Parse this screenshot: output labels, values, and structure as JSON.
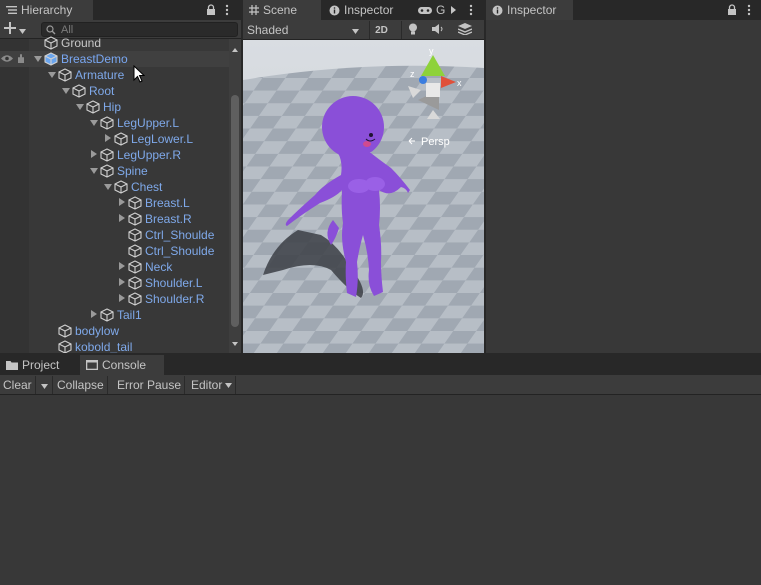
{
  "hierarchy": {
    "tab_label": "Hierarchy",
    "search_placeholder": "All",
    "items": [
      {
        "label": "Ground",
        "depth": 1,
        "arrow": "",
        "style": "white"
      },
      {
        "label": "BreastDemo",
        "depth": 1,
        "arrow": "down",
        "style": "sel"
      },
      {
        "label": "Armature",
        "depth": 2,
        "arrow": "down",
        "style": "blue"
      },
      {
        "label": "Root",
        "depth": 3,
        "arrow": "down",
        "style": "blue"
      },
      {
        "label": "Hip",
        "depth": 4,
        "arrow": "down",
        "style": "blue"
      },
      {
        "label": "LegUpper.L",
        "depth": 5,
        "arrow": "down",
        "style": "blue"
      },
      {
        "label": "LegLower.L",
        "depth": 6,
        "arrow": "right",
        "style": "blue"
      },
      {
        "label": "LegUpper.R",
        "depth": 5,
        "arrow": "right",
        "style": "blue"
      },
      {
        "label": "Spine",
        "depth": 5,
        "arrow": "down",
        "style": "blue"
      },
      {
        "label": "Chest",
        "depth": 6,
        "arrow": "down",
        "style": "blue"
      },
      {
        "label": "Breast.L",
        "depth": 7,
        "arrow": "right",
        "style": "blue"
      },
      {
        "label": "Breast.R",
        "depth": 7,
        "arrow": "right",
        "style": "blue"
      },
      {
        "label": "Ctrl_Shoulde",
        "depth": 7,
        "arrow": "",
        "style": "blue"
      },
      {
        "label": "Ctrl_Shoulde",
        "depth": 7,
        "arrow": "",
        "style": "blue"
      },
      {
        "label": "Neck",
        "depth": 7,
        "arrow": "right",
        "style": "blue"
      },
      {
        "label": "Shoulder.L",
        "depth": 7,
        "arrow": "right",
        "style": "blue"
      },
      {
        "label": "Shoulder.R",
        "depth": 7,
        "arrow": "right",
        "style": "blue"
      },
      {
        "label": "Tail1",
        "depth": 5,
        "arrow": "right",
        "style": "blue"
      },
      {
        "label": "bodylow",
        "depth": 2,
        "arrow": "",
        "style": "blue"
      },
      {
        "label": "kobold_tail",
        "depth": 2,
        "arrow": "",
        "style": "blue"
      }
    ]
  },
  "scene": {
    "tabs": [
      {
        "label": "Scene",
        "icon": "grid-icon"
      },
      {
        "label": "Inspector",
        "icon": "info-icon"
      },
      {
        "label": "G",
        "icon": "gamepad-icon"
      }
    ],
    "shading_mode": "Shaded",
    "mode_2d": "2D",
    "persp_label": "Persp",
    "gizmo_axes": {
      "x": "x",
      "y": "y",
      "z": "z"
    },
    "colors": {
      "x_axis": "#e0503a",
      "y_axis": "#8ed23a",
      "z_axis": "#3a7de0",
      "character": "#8a4fd8"
    }
  },
  "inspector": {
    "tab_label": "Inspector"
  },
  "bottom": {
    "tabs": [
      {
        "label": "Project",
        "icon": "folder-icon"
      },
      {
        "label": "Console",
        "icon": "console-icon"
      }
    ],
    "toolbar": {
      "clear": "Clear",
      "collapse": "Collapse",
      "error_pause": "Error Pause",
      "editor": "Editor"
    }
  }
}
